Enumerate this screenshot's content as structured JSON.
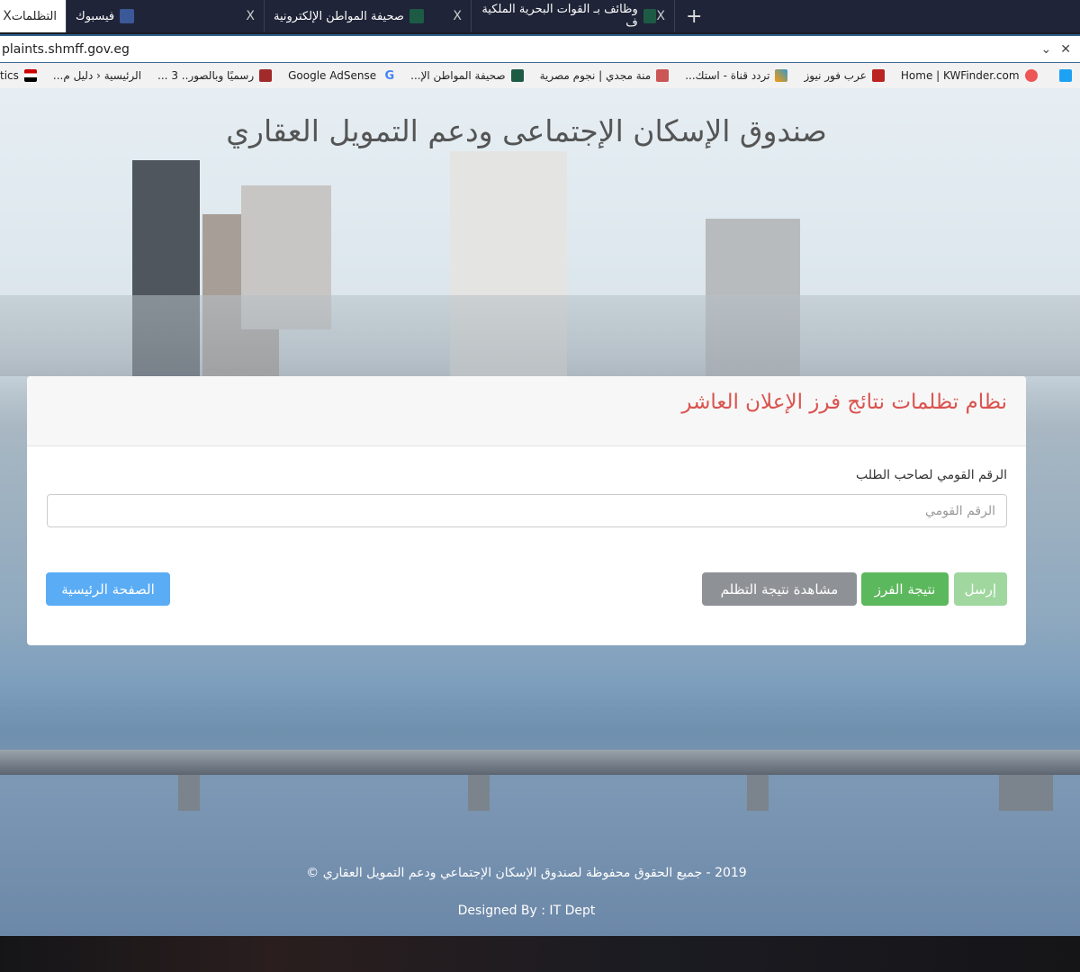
{
  "browser": {
    "tabs": [
      {
        "label": "التظلمات",
        "active": true
      },
      {
        "label": "فيسبوك",
        "icon": "facebook-icon"
      },
      {
        "label": "صحيفة المواطن الإلكترونية",
        "icon": "site-icon"
      },
      {
        "label": "وظائف بـ القوات البحرية الملكية ف",
        "icon": "site-icon"
      }
    ],
    "new_tab": "+",
    "close": "X",
    "url": "plaints.shmff.gov.eg",
    "bookmarks": [
      "tics",
      "الرئيسية ‹ دليل م...",
      "رسميًا وبالصور.. 3 ...",
      "Google AdSense",
      "صحيفة المواطن الإ...",
      "منة مجدي | نجوم مصرية",
      "تردد قناة - استك...",
      "عرب فور نيوز",
      "Home | KWFinder.com"
    ]
  },
  "page": {
    "site_title": "صندوق الإسكان الإجتماعى ودعم التمويل العقاري",
    "card_title": "نظام تظلمات نتائج فرز الإعلان العاشر",
    "field_label": "الرقم القومي لصاحب الطلب",
    "field_placeholder": "الرقم القومي",
    "field_value": "",
    "buttons": {
      "send": "إرسل",
      "result": "نتيجة الفرز",
      "view": "مشاهدة نتيجة التظلم",
      "home": "الصفحة الرئيسية"
    },
    "footer_copyright": "2019 - جميع الحقوق محفوظة لصندوق الإسكان الإجتماعي ودعم التمويل العقاري ©",
    "footer_designed": "Designed By : IT Dept"
  },
  "colors": {
    "card_title": "#d9534f",
    "send": "#9fd79f",
    "result": "#5cb85c",
    "view": "#8e9296",
    "home": "#5aacf5"
  }
}
